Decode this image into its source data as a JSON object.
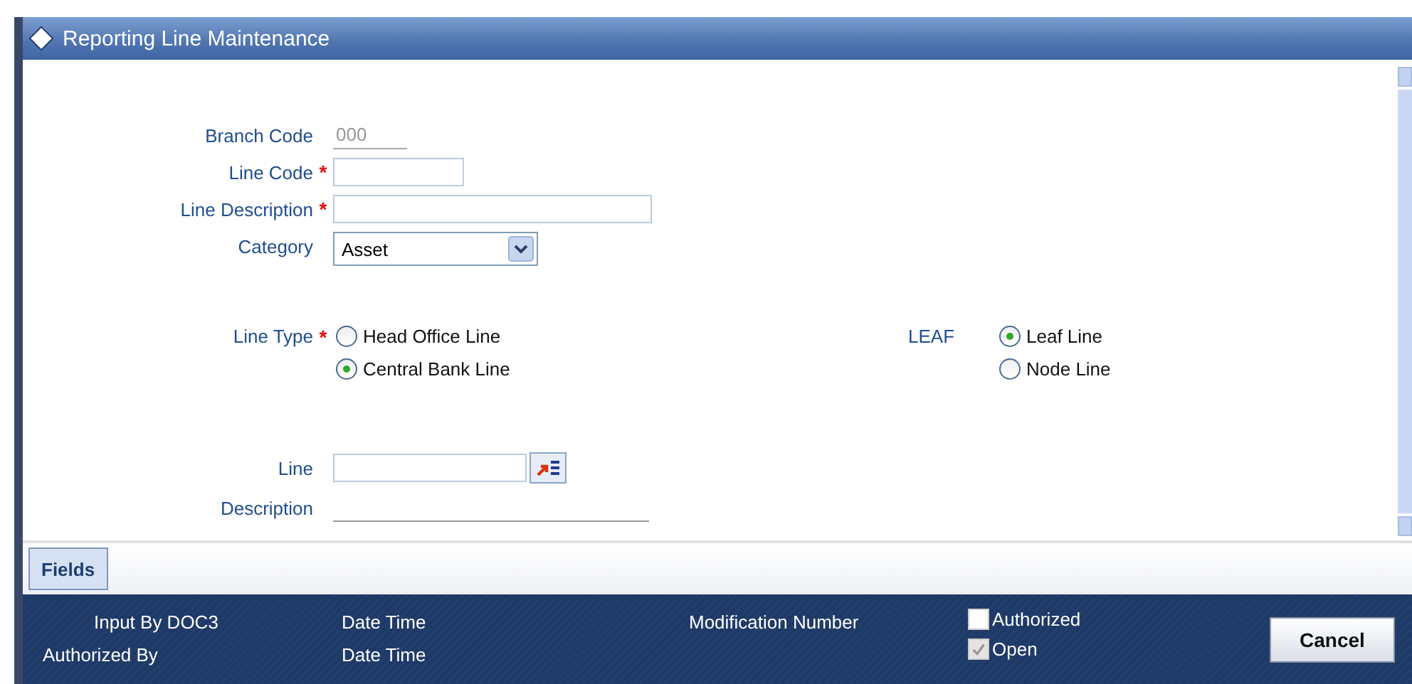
{
  "window": {
    "title": "Reporting Line Maintenance"
  },
  "fields": [
    {
      "label": "Branch Code",
      "kind": "readonly",
      "value": "000"
    },
    {
      "label": "Line Code",
      "required_mark": "*",
      "kind": "text"
    },
    {
      "label": "Line Description",
      "required_mark": "*",
      "kind": "wide"
    },
    {
      "label": "Category",
      "kind": "select",
      "value": "Asset"
    }
  ],
  "line_type": {
    "label": "Line Type",
    "required_mark": "*",
    "options": [
      {
        "label": "Head Office Line",
        "selected": false
      },
      {
        "label": "Central Bank Line",
        "selected": true
      }
    ]
  },
  "leaf": {
    "label": "LEAF",
    "options": [
      {
        "label": "Leaf Line",
        "selected": true
      },
      {
        "label": "Node Line",
        "selected": false
      }
    ]
  },
  "line": {
    "label": "Line",
    "description_label": "Description"
  },
  "tabs": [
    {
      "label": "Fields",
      "selected": true
    }
  ],
  "audit": {
    "input_by": "Input By DOC3",
    "input_date": "Date Time",
    "authorized_by": "Authorized By",
    "authorized_date": "Date Time",
    "modification_number": "Modification Number",
    "checks": [
      {
        "label": "Authorized",
        "checked": false,
        "disabled": false
      },
      {
        "label": "Open",
        "checked": true,
        "disabled": true
      }
    ]
  },
  "buttons": [
    {
      "label": "Cancel"
    }
  ]
}
